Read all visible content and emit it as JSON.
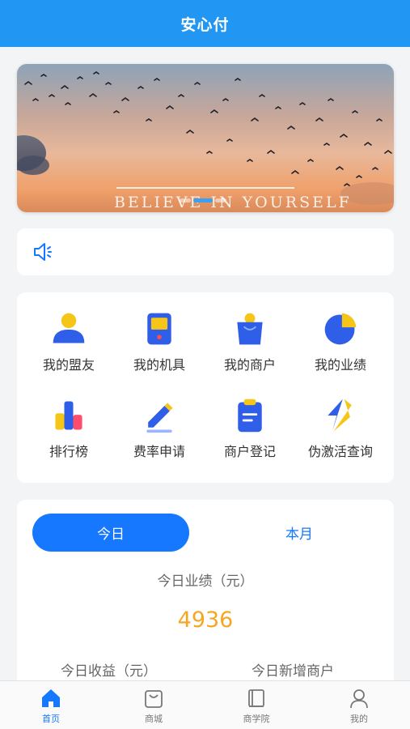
{
  "header": {
    "title": "安心付"
  },
  "banner": {
    "text": "BELIEVE IN YOURSELF"
  },
  "notice": {
    "icon": "speaker-icon"
  },
  "menu": {
    "items": [
      {
        "label": "我的盟友",
        "icon": "user-icon"
      },
      {
        "label": "我的机具",
        "icon": "pos-device-icon"
      },
      {
        "label": "我的商户",
        "icon": "shop-bag-icon"
      },
      {
        "label": "我的业绩",
        "icon": "pie-chart-icon"
      },
      {
        "label": "排行榜",
        "icon": "ranking-bars-icon"
      },
      {
        "label": "费率申请",
        "icon": "pencil-icon"
      },
      {
        "label": "商户登记",
        "icon": "clipboard-icon"
      },
      {
        "label": "伪激活查询",
        "icon": "lightning-icon"
      }
    ]
  },
  "stats": {
    "tabs": [
      {
        "label": "今日",
        "active": true
      },
      {
        "label": "本月",
        "active": false
      }
    ],
    "performance_label": "今日业绩（元）",
    "performance_value": "4936",
    "income_label": "今日收益（元）",
    "new_merchants_label": "今日新增商户"
  },
  "tabbar": {
    "items": [
      {
        "label": "首页",
        "icon": "home-icon",
        "active": true
      },
      {
        "label": "商城",
        "icon": "shopping-bag-icon",
        "active": false
      },
      {
        "label": "商学院",
        "icon": "book-icon",
        "active": false
      },
      {
        "label": "我的",
        "icon": "profile-icon",
        "active": false
      }
    ]
  },
  "colors": {
    "primary": "#2196f3",
    "accent": "#1677ff",
    "value": "#f5a623",
    "icon_yellow": "#f5c518",
    "icon_blue": "#2f5fe8"
  }
}
